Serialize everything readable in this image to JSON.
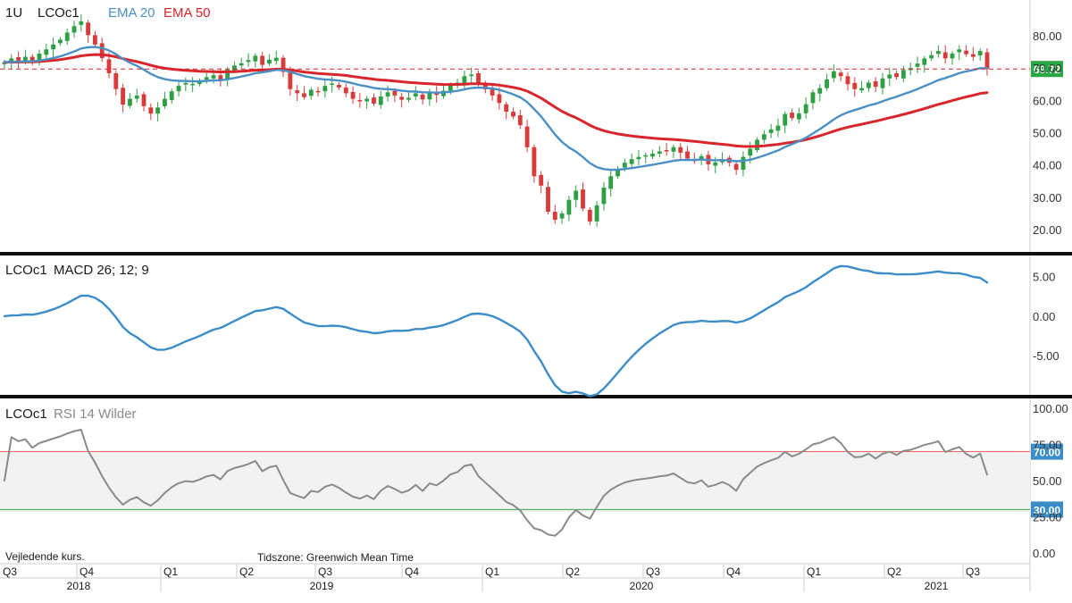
{
  "header": {
    "interval": "1U",
    "symbol": "LCOc1",
    "ema20_label": "EMA 20",
    "ema50_label": "EMA 50"
  },
  "macd_panel": {
    "symbol": "LCOc1",
    "label": "MACD 26; 12; 9"
  },
  "rsi_panel": {
    "symbol": "LCOc1",
    "label": "RSI 14 Wilder"
  },
  "footer": {
    "disclaimer": "Vejledende kurs.",
    "timezone": "Tidszone: Greenwich Mean Time"
  },
  "colors": {
    "up": "#2ea043",
    "down": "#d93a3a",
    "ema20": "#4a90c4",
    "ema50": "#d8262c",
    "macd": "#3b8dc8",
    "rsi": "#8a8a8a",
    "last_price_badge": "#28a745",
    "rsi70": "#e05a47",
    "rsi30": "#3aa64a",
    "rsi_badge": "#3b8dc8"
  },
  "chart_data": [
    {
      "type": "candlestick",
      "title": "LCOc1",
      "series_labels": [
        "EMA 20",
        "EMA 50"
      ],
      "y_ticks": [
        "80.00",
        "70.00",
        "60.00",
        "50.00",
        "40.00",
        "30.00",
        "20.00"
      ],
      "ylim": [
        15,
        85
      ],
      "last_price": "69.72",
      "x_quarters": [
        "Q3",
        "Q4",
        "Q1",
        "Q2",
        "Q3",
        "Q4",
        "Q1",
        "Q2",
        "Q3",
        "Q4",
        "Q1",
        "Q2",
        "Q3"
      ],
      "x_years": [
        "2018",
        "2019",
        "2020",
        "2021"
      ],
      "close": [
        71.8,
        73.0,
        72.3,
        73.5,
        72.0,
        74.5,
        75.8,
        77.3,
        78.8,
        81.0,
        83.0,
        84.5,
        80.2,
        77.3,
        73.1,
        68.4,
        63.5,
        58.7,
        60.5,
        61.5,
        58.2,
        55.9,
        57.8,
        60.5,
        62.8,
        64.5,
        65.4,
        65.1,
        66.0,
        67.2,
        67.8,
        66.3,
        69.5,
        70.8,
        71.5,
        72.5,
        73.8,
        71.0,
        72.6,
        73.2,
        68.8,
        63.5,
        62.2,
        61.0,
        63.3,
        62.8,
        64.5,
        65.2,
        64.0,
        62.2,
        60.5,
        59.7,
        60.5,
        59.0,
        61.2,
        62.5,
        61.5,
        60.2,
        60.8,
        62.2,
        60.3,
        62.3,
        61.7,
        63.0,
        64.8,
        65.5,
        67.5,
        68.0,
        65.2,
        63.4,
        61.5,
        59.2,
        56.5,
        55.0,
        52.3,
        45.5,
        36.5,
        33.6,
        25.5,
        23.0,
        25.0,
        29.2,
        32.0,
        26.5,
        22.5,
        27.5,
        33.0,
        36.5,
        38.8,
        40.7,
        41.8,
        42.5,
        43.0,
        43.5,
        44.2,
        44.5,
        45.5,
        43.8,
        42.0,
        41.5,
        42.7,
        40.2,
        40.8,
        41.8,
        40.7,
        38.5,
        42.5,
        45.0,
        47.8,
        49.5,
        51.0,
        52.2,
        55.8,
        54.5,
        56.0,
        58.8,
        62.5,
        63.8,
        66.5,
        69.0,
        67.5,
        65.0,
        63.5,
        63.8,
        65.5,
        64.2,
        66.8,
        68.0,
        67.2,
        69.4,
        70.0,
        71.4,
        73.0,
        74.0,
        75.3,
        73.0,
        74.5,
        75.8,
        74.3,
        73.5,
        75.3,
        69.72
      ]
    },
    {
      "type": "line",
      "title": "LCOc1 MACD 26; 12; 9",
      "y_ticks": [
        "5.00",
        "0.00",
        "-5.00"
      ],
      "ylim": [
        -9.5,
        7.0
      ]
    },
    {
      "type": "line",
      "title": "LCOc1 RSI 14 Wilder",
      "y_ticks": [
        "100.00",
        "75.00",
        "50.00",
        "25.00",
        "0.00"
      ],
      "ylim": [
        0,
        100
      ],
      "levels": [
        "70.00",
        "30.00"
      ]
    }
  ]
}
